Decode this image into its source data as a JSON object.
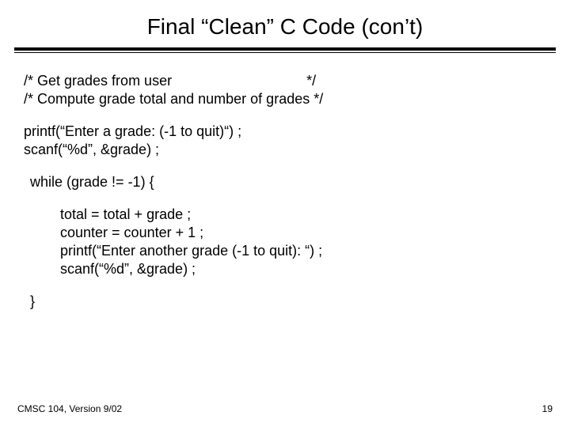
{
  "title": "Final “Clean” C Code (con’t)",
  "comments": {
    "l1": "/* Get grades from user                                  */",
    "l2": "/* Compute grade total and number of grades */"
  },
  "code": {
    "printf1": "printf(“Enter a grade: (-1 to quit)“) ;",
    "scanf1": "scanf(“%d”, &grade) ;",
    "while": "while (grade != -1) {",
    "body1": "total = total + grade ;",
    "body2": "counter = counter + 1 ;",
    "body3": "printf(“Enter another grade (-1 to quit): “) ;",
    "body4": "scanf(“%d”, &grade) ;",
    "close": "}"
  },
  "footer": {
    "left": "CMSC 104, Version 9/02",
    "right": "19"
  }
}
